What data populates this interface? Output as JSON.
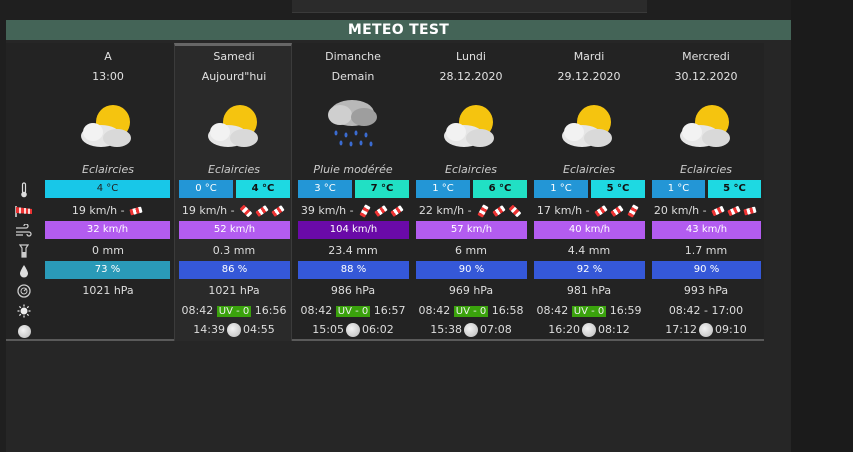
{
  "widget": {
    "title": "METEO TEST"
  },
  "icons": [
    "thermometer-icon",
    "windsock-icon",
    "wind-gust-icon",
    "rain-gauge-icon",
    "humidity-drop-icon",
    "barometer-icon",
    "sun-icon",
    "moon-icon"
  ],
  "colors": {
    "header": "#446457",
    "temp_min": "#2396d6",
    "temp_max": "#1ed9e2",
    "wind": "#b35cf0",
    "humidity": "#3558d8",
    "uv": "#3aa20c"
  },
  "columns": [
    {
      "day": "A",
      "sub": "13:00",
      "icon": "partly-cloudy-icon",
      "condition": "Eclaircies",
      "temp": "4 °C",
      "wind": "19 km/h -",
      "gust": "32 km/h",
      "rain": "0 mm",
      "humidity": "73 %",
      "humidity_value": 73,
      "pressure": "1021 hPa"
    },
    {
      "day": "Samedi",
      "sub": "Aujourd\"hui",
      "icon": "partly-cloudy-icon",
      "condition": "Eclaircies",
      "tmin": "0 °C",
      "tmax": "4 °C",
      "wind": "19 km/h -",
      "gust": "52 km/h",
      "rain": "0.3 mm",
      "humidity": "86 %",
      "humidity_value": 86,
      "pressure": "1021 hPa",
      "sunrise": "08:42",
      "uv": "UV - 0",
      "sunset": "16:56",
      "moonrise": "14:39",
      "moonset": "04:55"
    },
    {
      "day": "Dimanche",
      "sub": "Demain",
      "icon": "rain-cloud-icon",
      "condition": "Pluie modérée",
      "tmin": "3 °C",
      "tmax": "7 °C",
      "wind": "39 km/h -",
      "gust": "104 km/h",
      "rain": "23.4 mm",
      "humidity": "88 %",
      "humidity_value": 88,
      "pressure": "986 hPa",
      "sunrise": "08:42",
      "uv": "UV - 0",
      "sunset": "16:57",
      "moonrise": "15:05",
      "moonset": "06:02"
    },
    {
      "day": "Lundi",
      "sub": "28.12.2020",
      "icon": "partly-cloudy-icon",
      "condition": "Eclaircies",
      "tmin": "1 °C",
      "tmax": "6 °C",
      "wind": "22 km/h -",
      "gust": "57 km/h",
      "rain": "6 mm",
      "humidity": "90 %",
      "humidity_value": 90,
      "pressure": "969 hPa",
      "sunrise": "08:42",
      "uv": "UV - 0",
      "sunset": "16:58",
      "moonrise": "15:38",
      "moonset": "07:08"
    },
    {
      "day": "Mardi",
      "sub": "29.12.2020",
      "icon": "partly-cloudy-icon",
      "condition": "Eclaircies",
      "tmin": "1 °C",
      "tmax": "5 °C",
      "wind": "17 km/h -",
      "gust": "40 km/h",
      "rain": "4.4 mm",
      "humidity": "92 %",
      "humidity_value": 92,
      "pressure": "981 hPa",
      "sunrise": "08:42",
      "uv": "UV - 0",
      "sunset": "16:59",
      "moonrise": "16:20",
      "moonset": "08:12"
    },
    {
      "day": "Mercredi",
      "sub": "30.12.2020",
      "icon": "partly-cloudy-icon",
      "condition": "Eclaircies",
      "tmin": "1 °C",
      "tmax": "5 °C",
      "wind": "20 km/h -",
      "gust": "43 km/h",
      "rain": "1.7 mm",
      "humidity": "90 %",
      "humidity_value": 90,
      "pressure": "993 hPa",
      "sun": "08:42 - 17:00",
      "moonrise": "17:12",
      "moonset": "09:10"
    }
  ]
}
